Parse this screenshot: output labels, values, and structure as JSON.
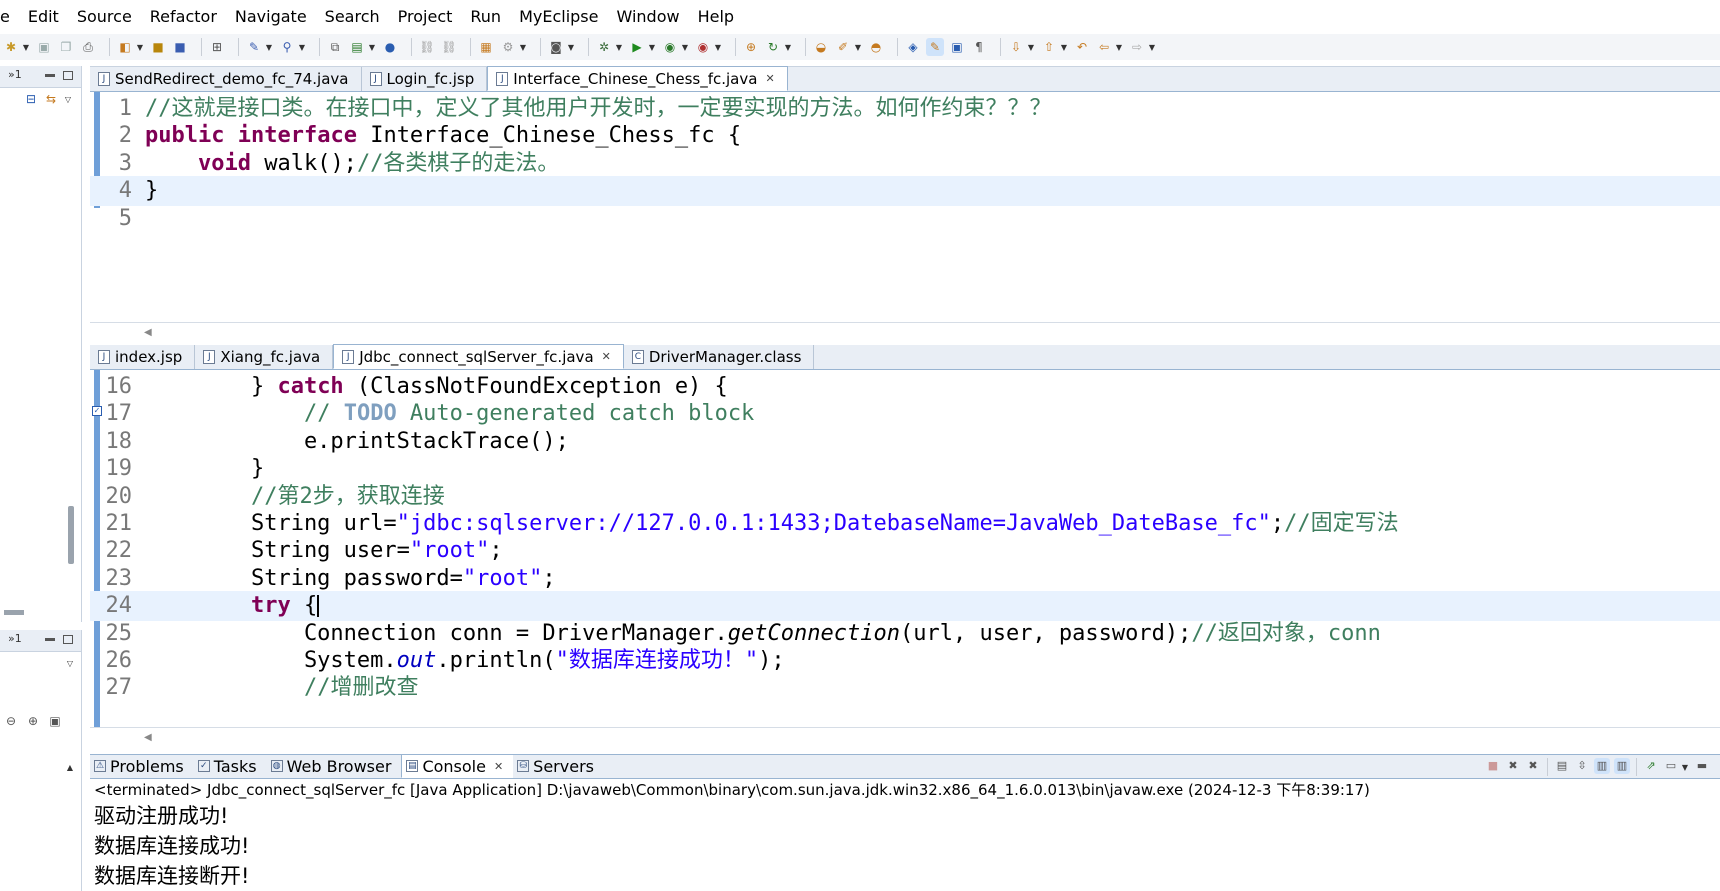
{
  "menubar": {
    "items": [
      "e",
      "Edit",
      "Source",
      "Refactor",
      "Navigate",
      "Search",
      "Project",
      "Run",
      "MyEclipse",
      "Window",
      "Help"
    ]
  },
  "left_panel": {
    "top_label": "»1",
    "bottom_label": "»1"
  },
  "top_editor": {
    "tabs": [
      {
        "label": "SendRedirect_demo_fc_74.java",
        "icon": "J",
        "active": false
      },
      {
        "label": "Login_fc.jsp",
        "icon": "J",
        "active": false
      },
      {
        "label": "Interface_Chinese_Chess_fc.java",
        "icon": "J",
        "active": true
      }
    ],
    "lines": [
      {
        "num": "1",
        "segments": [
          {
            "cls": "cm",
            "text": "//这就是接口类。在接口中，定义了其他用户开发时，一定要实现的方法。如何作约束？？？"
          }
        ]
      },
      {
        "num": "2",
        "segments": [
          {
            "cls": "kw",
            "text": "public"
          },
          {
            "cls": "",
            "text": " "
          },
          {
            "cls": "kw",
            "text": "interface"
          },
          {
            "cls": "",
            "text": " Interface_Chinese_Chess_fc {"
          }
        ]
      },
      {
        "num": "3",
        "segments": [
          {
            "cls": "",
            "text": "    "
          },
          {
            "cls": "kw",
            "text": "void"
          },
          {
            "cls": "",
            "text": " walk();"
          },
          {
            "cls": "cm",
            "text": "//各类棋子的走法。"
          }
        ]
      },
      {
        "num": "4",
        "segments": [
          {
            "cls": "",
            "text": "}"
          }
        ]
      },
      {
        "num": "5",
        "segments": [
          {
            "cls": "",
            "text": ""
          }
        ]
      }
    ]
  },
  "mid_editor": {
    "tabs": [
      {
        "label": "index.jsp",
        "icon": "J",
        "active": false
      },
      {
        "label": "Xiang_fc.java",
        "icon": "J",
        "active": false
      },
      {
        "label": "Jdbc_connect_sqlServer_fc.java",
        "icon": "J",
        "active": true
      },
      {
        "label": "DriverManager.class",
        "icon": "C",
        "active": false
      }
    ],
    "lines": [
      {
        "num": "16",
        "segments": [
          {
            "cls": "",
            "text": "        } "
          },
          {
            "cls": "kw",
            "text": "catch"
          },
          {
            "cls": "",
            "text": " (ClassNotFoundException e) {"
          }
        ]
      },
      {
        "num": "17",
        "segments": [
          {
            "cls": "",
            "text": "            "
          },
          {
            "cls": "cm",
            "text": "// "
          },
          {
            "cls": "todo",
            "text": "TODO"
          },
          {
            "cls": "cm",
            "text": " Auto-generated catch block"
          }
        ]
      },
      {
        "num": "18",
        "segments": [
          {
            "cls": "",
            "text": "            e.printStackTrace();"
          }
        ]
      },
      {
        "num": "19",
        "segments": [
          {
            "cls": "",
            "text": "        }"
          }
        ]
      },
      {
        "num": "20",
        "segments": [
          {
            "cls": "",
            "text": "        "
          },
          {
            "cls": "cm",
            "text": "//第2步，获取连接"
          }
        ]
      },
      {
        "num": "21",
        "segments": [
          {
            "cls": "",
            "text": "        String url="
          },
          {
            "cls": "str",
            "text": "\"jdbc:sqlserver://127.0.0.1:1433;DatebaseName=JavaWeb_DateBase_fc\""
          },
          {
            "cls": "",
            "text": ";"
          },
          {
            "cls": "cm",
            "text": "//固定写法"
          }
        ]
      },
      {
        "num": "22",
        "segments": [
          {
            "cls": "",
            "text": "        String user="
          },
          {
            "cls": "str",
            "text": "\"root\""
          },
          {
            "cls": "",
            "text": ";"
          }
        ]
      },
      {
        "num": "23",
        "segments": [
          {
            "cls": "",
            "text": "        String password="
          },
          {
            "cls": "str",
            "text": "\"root\""
          },
          {
            "cls": "",
            "text": ";"
          }
        ]
      },
      {
        "num": "24",
        "segments": [
          {
            "cls": "",
            "text": "        "
          },
          {
            "cls": "kw",
            "text": "try"
          },
          {
            "cls": "",
            "text": " {"
          }
        ]
      },
      {
        "num": "25",
        "segments": [
          {
            "cls": "",
            "text": "            Connection conn = DriverManager."
          },
          {
            "cls": "it",
            "text": "getConnection"
          },
          {
            "cls": "",
            "text": "(url, user, password);"
          },
          {
            "cls": "cm",
            "text": "//返回对象，conn"
          }
        ]
      },
      {
        "num": "26",
        "segments": [
          {
            "cls": "",
            "text": "            System."
          },
          {
            "cls": "fld",
            "text": "out"
          },
          {
            "cls": "",
            "text": ".println("
          },
          {
            "cls": "str",
            "text": "\"数据库连接成功！\""
          },
          {
            "cls": "",
            "text": ");"
          }
        ]
      },
      {
        "num": "27",
        "segments": [
          {
            "cls": "",
            "text": "            "
          },
          {
            "cls": "cm",
            "text": "//增删改查"
          }
        ]
      }
    ]
  },
  "console": {
    "tabs": [
      {
        "label": "Problems",
        "active": false
      },
      {
        "label": "Tasks",
        "active": false
      },
      {
        "label": "Web Browser",
        "active": false
      },
      {
        "label": "Console",
        "active": true
      },
      {
        "label": "Servers",
        "active": false
      }
    ],
    "status": "<terminated> Jdbc_connect_sqlServer_fc [Java Application] D:\\javaweb\\Common\\binary\\com.sun.java.jdk.win32.x86_64_1.6.0.013\\bin\\javaw.exe (2024-12-3 下午8:39:17)",
    "output": [
      "驱动注册成功!",
      "数据库连接成功!",
      "数据库连接断开!"
    ]
  }
}
